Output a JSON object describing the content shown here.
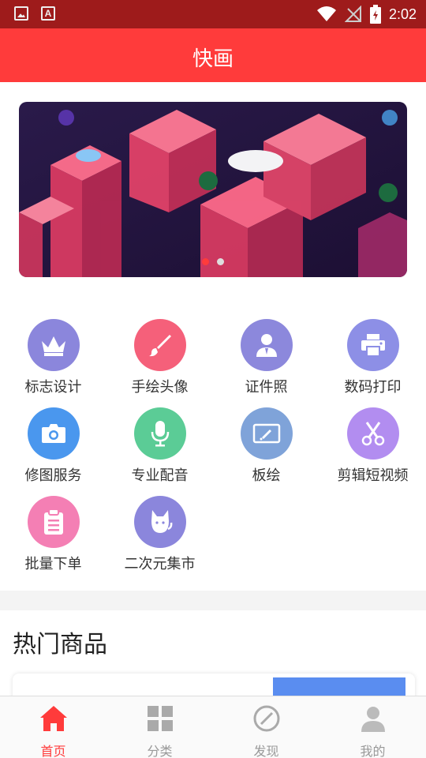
{
  "status_bar": {
    "time": "2:02"
  },
  "appbar": {
    "title": "快画"
  },
  "banner": {
    "slide_count": 2,
    "active_slide": 1
  },
  "services": [
    {
      "label": "标志设计",
      "icon": "crown-icon",
      "color": "#8b86dc"
    },
    {
      "label": "手绘头像",
      "icon": "brush-icon",
      "color": "#f5607a"
    },
    {
      "label": "证件照",
      "icon": "person-id-icon",
      "color": "#8c88dc"
    },
    {
      "label": "数码打印",
      "icon": "printer-icon",
      "color": "#8d8fe6"
    },
    {
      "label": "修图服务",
      "icon": "camera-icon",
      "color": "#4a97ee"
    },
    {
      "label": "专业配音",
      "icon": "microphone-icon",
      "color": "#5bcc96"
    },
    {
      "label": "板绘",
      "icon": "drawing-tablet-icon",
      "color": "#7fa3d9"
    },
    {
      "label": "剪辑短视频",
      "icon": "scissors-icon",
      "color": "#b28df0"
    },
    {
      "label": "批量下单",
      "icon": "clipboard-icon",
      "color": "#f47fb4"
    },
    {
      "label": "二次元集市",
      "icon": "cat-icon",
      "color": "#8b86dc"
    }
  ],
  "hot": {
    "title": "热门商品"
  },
  "nav": [
    {
      "label": "首页",
      "icon": "home-icon",
      "active": true
    },
    {
      "label": "分类",
      "icon": "grid-icon",
      "active": false
    },
    {
      "label": "发现",
      "icon": "compass-icon",
      "active": false
    },
    {
      "label": "我的",
      "icon": "user-icon",
      "active": false
    }
  ],
  "colors": {
    "primary": "#ff3b3b",
    "status_bar": "#9e1b1b",
    "inactive": "#999999"
  }
}
